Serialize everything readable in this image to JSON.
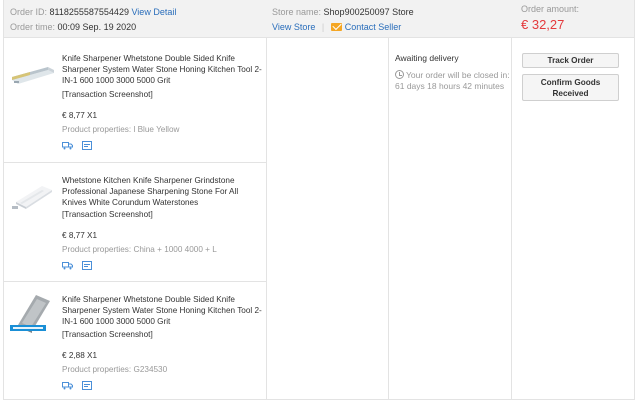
{
  "header": {
    "order_id_label": "Order ID:",
    "order_id": "8118255587554429",
    "view_detail": "View Detail",
    "order_time_label": "Order time:",
    "order_time": "00:09 Sep. 19 2020",
    "store_name_label": "Store name:",
    "store_name": "Shop900250097 Store",
    "view_store": "View Store",
    "divider": "|",
    "contact_seller": "Contact Seller",
    "order_amount_label": "Order amount:",
    "order_amount": "€ 32,27"
  },
  "items": [
    {
      "title": "Knife Sharpener Whetstone Double Sided Knife Sharpener System Water Stone Honing Kitchen Tool 2-IN-1 600 1000 3000 5000 Grit",
      "screenshot": "[Transaction Screenshot]",
      "price": "€ 8,77 X1",
      "props_label": "Product properties:",
      "props": "l Blue Yellow"
    },
    {
      "title": "Whetstone Kitchen Knife Sharpener Grindstone Professional Japanese Sharpening Stone For All Knives White Corundum Waterstones",
      "screenshot": "[Transaction Screenshot]",
      "price": "€ 8,77 X1",
      "props_label": "Product properties:",
      "props": "China + 1000 4000 + L"
    },
    {
      "title": "Knife Sharpener Whetstone Double Sided Knife Sharpener System Water Stone Honing Kitchen Tool 2-IN-1 600 1000 3000 5000 Grit",
      "screenshot": "[Transaction Screenshot]",
      "price": "€ 2,88 X1",
      "props_label": "Product properties:",
      "props": "G234530"
    }
  ],
  "status": {
    "label": "Awaiting delivery",
    "note": "Your order will be closed in: 61 days 18 hours 42 minutes"
  },
  "actions": {
    "track_order": "Track Order",
    "confirm_goods": "Confirm Goods Received"
  },
  "colors": {
    "link": "#2a6ebb",
    "amount": "#e4393c",
    "service_icon": "#4a8fd8"
  }
}
